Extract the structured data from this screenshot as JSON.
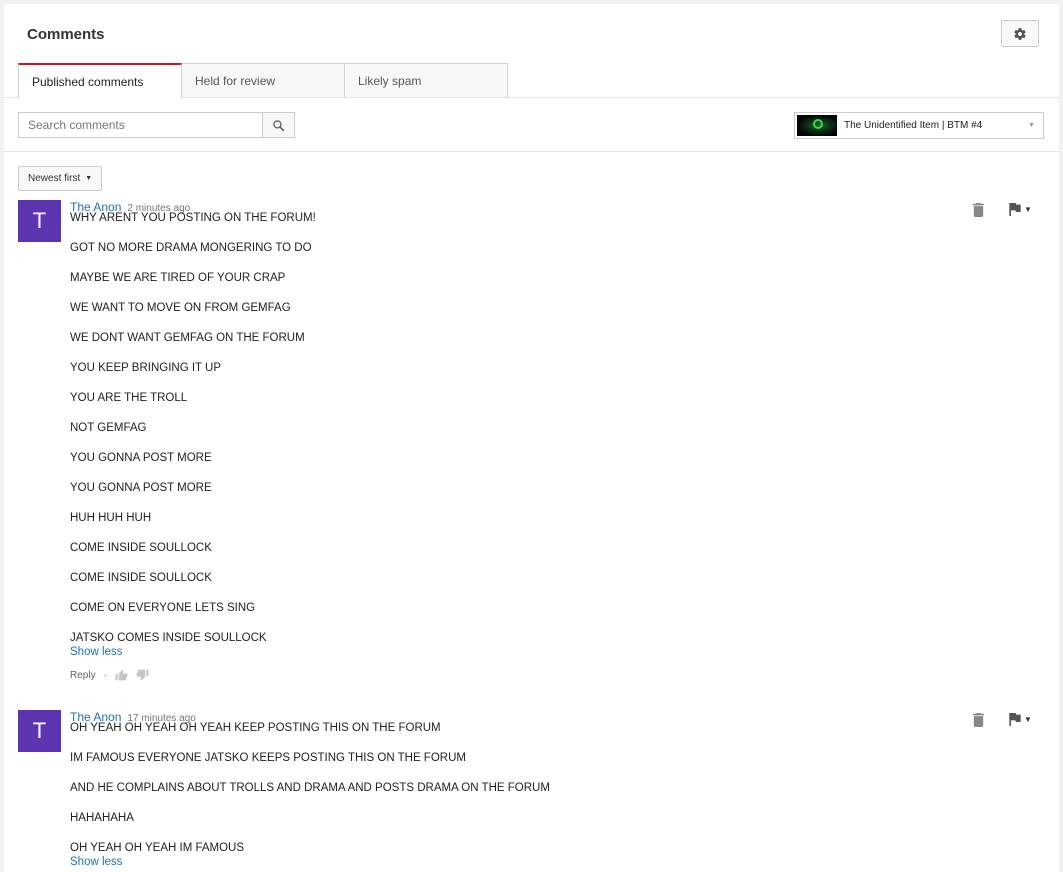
{
  "header": {
    "title": "Comments",
    "settings_icon": "gear-icon"
  },
  "tabs": [
    {
      "label": "Published comments",
      "active": true
    },
    {
      "label": "Held for review",
      "active": false
    },
    {
      "label": "Likely spam",
      "active": false
    }
  ],
  "search": {
    "placeholder": "Search comments",
    "icon": "search-icon"
  },
  "video_selector": {
    "title": "The Unidentified Item | BTM #4"
  },
  "sort": {
    "label": "Newest first"
  },
  "comments": [
    {
      "avatar_letter": "T",
      "avatar_color": "#5e35b1",
      "author": "The Anon",
      "time": "2 minutes ago",
      "lines": [
        "WHY ARENT YOU POSTING ON THE FORUM!",
        "GOT NO MORE DRAMA MONGERING TO DO",
        "MAYBE WE ARE TIRED OF YOUR CRAP",
        "WE WANT TO MOVE ON FROM GEMFAG",
        "WE DONT WANT GEMFAG ON THE FORUM",
        "YOU KEEP BRINGING IT UP",
        "YOU ARE THE TROLL",
        "NOT GEMFAG",
        "YOU GONNA POST MORE",
        "YOU GONNA POST MORE",
        "HUH HUH HUH",
        "COME INSIDE SOULLOCK",
        "COME INSIDE SOULLOCK",
        "COME ON EVERYONE LETS SING",
        "JATSKO COMES INSIDE SOULLOCK"
      ],
      "show_less": "Show less",
      "reply": "Reply",
      "separator": "·"
    },
    {
      "avatar_letter": "T",
      "avatar_color": "#5e35b1",
      "author": "The Anon",
      "time": "17 minutes ago",
      "lines": [
        "OH YEAH OH YEAH OH YEAH KEEP POSTING THIS ON THE FORUM",
        "IM FAMOUS EVERYONE JATSKO KEEPS POSTING THIS ON THE FORUM",
        "AND HE COMPLAINS ABOUT TROLLS AND DRAMA AND POSTS DRAMA ON THE FORUM",
        "HAHAHAHA",
        "OH YEAH OH YEAH IM FAMOUS"
      ],
      "show_less": "Show less"
    }
  ],
  "colors": {
    "accent_red": "#cc181e",
    "link_blue": "#1f73b7"
  }
}
